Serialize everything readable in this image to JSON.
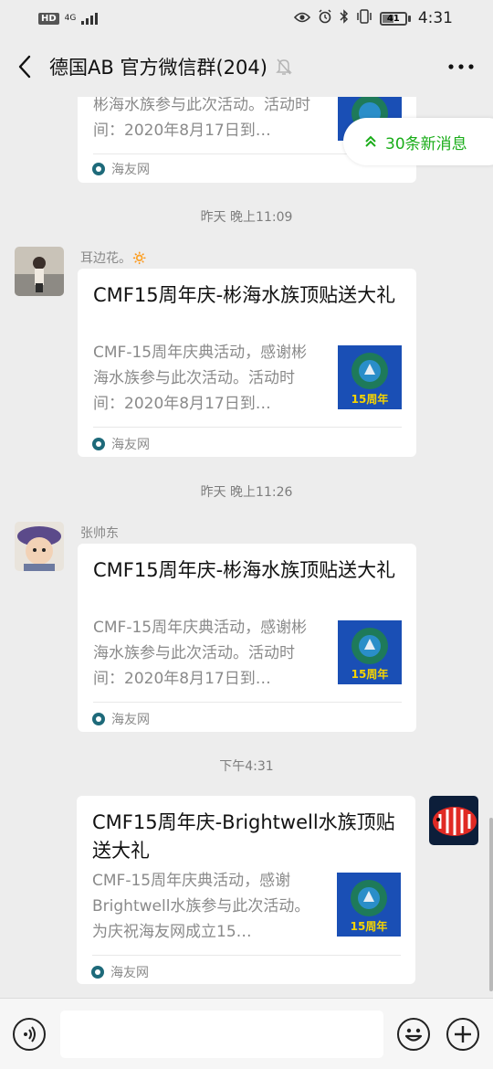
{
  "status_bar": {
    "hd": "HD",
    "network": "4G",
    "battery": "41",
    "time": "4:31"
  },
  "nav": {
    "title": "德国AB  官方微信群(204)"
  },
  "new_messages": "30条新消息",
  "messages": [
    {
      "timestamp": "",
      "sender": "",
      "title": "",
      "desc": "彬海水族参与此次活动。活动时间：2020年8月17日到…",
      "source": "海友网"
    },
    {
      "timestamp": "昨天 晚上11:09",
      "sender": "耳边花。🔅",
      "title": "CMF15周年庆-彬海水族顶贴送大礼",
      "desc": "CMF-15周年庆典活动，感谢彬海水族参与此次活动。活动时间：2020年8月17日到…",
      "thumb_text": "15周年",
      "source": "海友网"
    },
    {
      "timestamp": "昨天 晚上11:26",
      "sender": "张帅东",
      "title": "CMF15周年庆-彬海水族顶贴送大礼",
      "desc": "CMF-15周年庆典活动，感谢彬海水族参与此次活动。活动时间：2020年8月17日到…",
      "thumb_text": "15周年",
      "source": "海友网"
    },
    {
      "timestamp": "下午4:31",
      "sender": "",
      "title": "CMF15周年庆-Brightwell水族顶贴送大礼",
      "desc": "CMF-15周年庆典活动，感谢Brightwell水族参与此次活动。为庆祝海友网成立15…",
      "thumb_text": "15周年",
      "source": "海友网"
    }
  ],
  "input": {
    "placeholder": ""
  },
  "colors": {
    "accent_green": "#1aad19",
    "chat_bg": "#ededed",
    "card_bg": "#ffffff",
    "thumb_blue": "#1a4fb5"
  }
}
